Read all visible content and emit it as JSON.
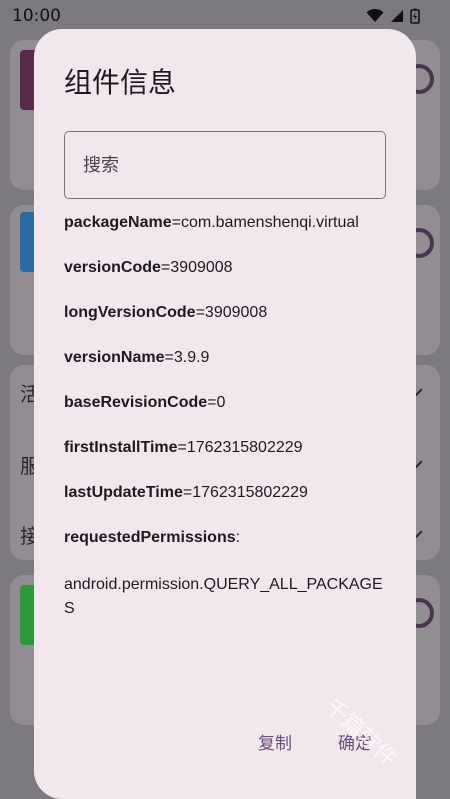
{
  "status_bar": {
    "time": "10:00"
  },
  "dialog": {
    "title": "组件信息",
    "search_placeholder": "搜索",
    "fields": [
      {
        "key": "packageName",
        "value": "=com.bamenshenqi.virtual"
      },
      {
        "key": "versionCode",
        "value": "=3909008"
      },
      {
        "key": "longVersionCode",
        "value": "=3909008"
      },
      {
        "key": "versionName",
        "value": "=3.9.9"
      },
      {
        "key": "baseRevisionCode",
        "value": "=0"
      },
      {
        "key": "firstInstallTime",
        "value": "=1762315802229"
      },
      {
        "key": "lastUpdateTime",
        "value": "=1762315802229"
      },
      {
        "key": "requestedPermissions",
        "value": ":"
      }
    ],
    "permissions": [
      "android.permission.QUERY_ALL_PACKAGES"
    ],
    "buttons": {
      "copy": "复制",
      "confirm": "确定"
    }
  },
  "background": {
    "labels": [
      "活",
      "服",
      "接"
    ]
  },
  "watermark": "千篇软件",
  "colors": {
    "dialog_bg": "#f2e7ec",
    "accent": "#6e4a7e",
    "scrim": "#7d7a7f"
  }
}
